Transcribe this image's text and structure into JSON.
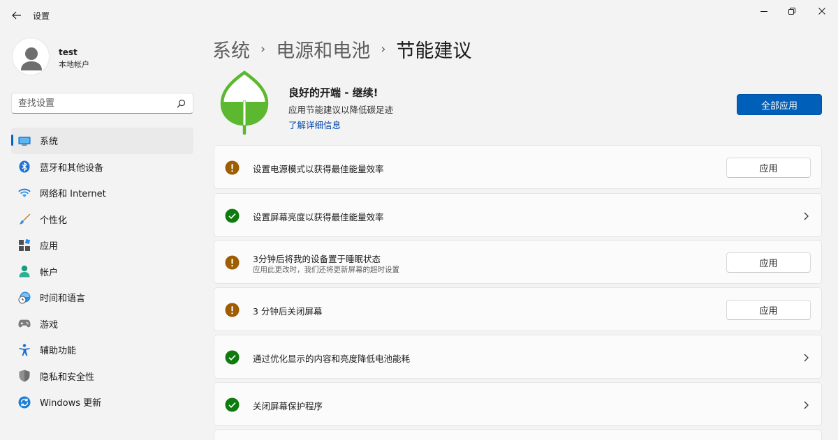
{
  "app": {
    "title": "设置"
  },
  "profile": {
    "name": "test",
    "account_type": "本地帐户"
  },
  "search": {
    "placeholder": "查找设置"
  },
  "sidebar": {
    "items": [
      {
        "label": "系统",
        "icon": "system-icon",
        "active": true
      },
      {
        "label": "蓝牙和其他设备",
        "icon": "bluetooth-icon"
      },
      {
        "label": "网络和 Internet",
        "icon": "wifi-icon"
      },
      {
        "label": "个性化",
        "icon": "brush-icon"
      },
      {
        "label": "应用",
        "icon": "apps-icon"
      },
      {
        "label": "帐户",
        "icon": "person-icon"
      },
      {
        "label": "时间和语言",
        "icon": "clock-globe-icon"
      },
      {
        "label": "游戏",
        "icon": "gamepad-icon"
      },
      {
        "label": "辅助功能",
        "icon": "accessibility-icon"
      },
      {
        "label": "隐私和安全性",
        "icon": "shield-icon"
      },
      {
        "label": "Windows 更新",
        "icon": "update-icon"
      }
    ]
  },
  "breadcrumb": {
    "level1": "系统",
    "level2": "电源和电池",
    "current": "节能建议"
  },
  "hero": {
    "title": "良好的开端 - 继续!",
    "subtitle": "应用节能建议以降低碳足迹",
    "link": "了解详细信息",
    "apply_all": "全部应用"
  },
  "recommendations": [
    {
      "title": "设置电源模式以获得最佳能量效率",
      "status": "warning",
      "action": "应用"
    },
    {
      "title": "设置屏幕亮度以获得最佳能量效率",
      "status": "done"
    },
    {
      "title": "3分钟后将我的设备置于睡眠状态",
      "desc": "应用此更改时，我们还将更新屏幕的超时设置",
      "status": "warning",
      "action": "应用"
    },
    {
      "title": "3 分钟后关闭屏幕",
      "status": "warning",
      "action": "应用"
    },
    {
      "title": "通过优化显示的内容和亮度降低电池能耗",
      "status": "done"
    },
    {
      "title": "关闭屏幕保护程序",
      "status": "done"
    }
  ],
  "colors": {
    "accent": "#005fb8",
    "warning": "#9d5d00",
    "success": "#0f7b0f",
    "leaf": "#5cb82e"
  }
}
